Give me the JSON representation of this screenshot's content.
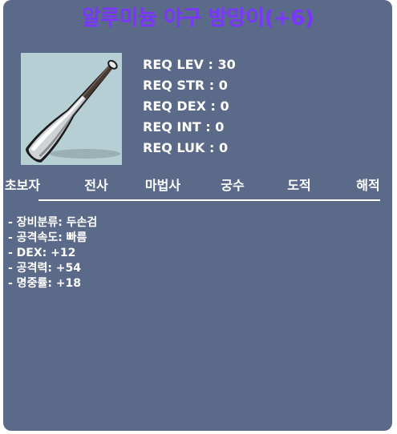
{
  "item": {
    "name": "알루미늄 야구 방망이(+6)",
    "icon": "aluminum-baseball-bat-icon",
    "title_color": "#7a35ff"
  },
  "requirements": [
    {
      "label": "REQ LEV",
      "value": "30"
    },
    {
      "label": "REQ STR",
      "value": "0"
    },
    {
      "label": "REQ DEX",
      "value": "0"
    },
    {
      "label": "REQ INT",
      "value": "0"
    },
    {
      "label": "REQ LUK",
      "value": "0"
    }
  ],
  "jobs": [
    "초보자",
    "전사",
    "마법사",
    "궁수",
    "도적",
    "해적"
  ],
  "stats": [
    "- 장비분류: 두손검",
    "- 공격속도: 빠름",
    "- DEX: +12",
    "- 공격력: +54",
    "- 명중률: +18"
  ]
}
